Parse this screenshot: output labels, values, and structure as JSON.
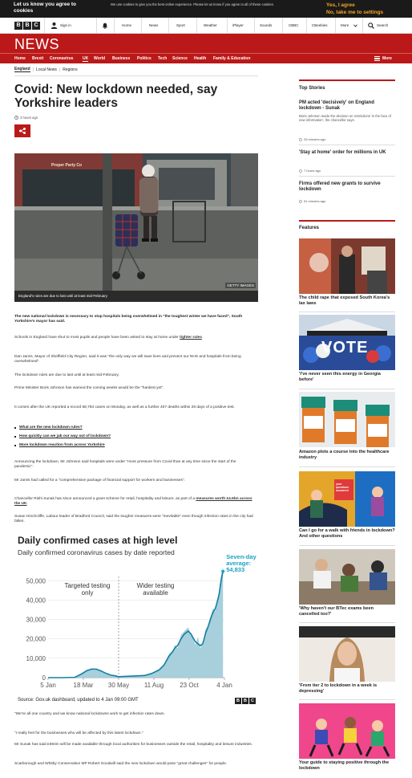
{
  "cookie": {
    "title": "Let us know you agree to cookies",
    "message": "We use cookies to give you the best online experience. Please let us know if you agree to all of these cookies.",
    "agree": "Yes, I agree",
    "settings": "No, take me to settings"
  },
  "topnav": {
    "signin": "Sign in",
    "items": [
      "Home",
      "News",
      "Sport",
      "Weather",
      "iPlayer",
      "Sounds",
      "CBBC",
      "CBeebies",
      "More"
    ],
    "search": "Search"
  },
  "banner": {
    "title": "NEWS",
    "more": "More"
  },
  "sections": [
    "Home",
    "Brexit",
    "Coronavirus",
    "UK",
    "World",
    "Business",
    "Politics",
    "Tech",
    "Science",
    "Health",
    "Family & Education"
  ],
  "subnav": [
    "England",
    "Local News",
    "Regions"
  ],
  "article": {
    "headline": "Covid: New lockdown needed, say Yorkshire leaders",
    "time": "3 hours ago",
    "image_caption": "England's rules are due to last until at least mid-February",
    "image_credit": "GETTY IMAGES",
    "image_shop": "Proper Party Co",
    "lead": "The new national lockdown is necessary to stop hospitals being overwhelmed in \"the toughest winter we have faced\", South Yorkshire's mayor has said.",
    "p1a": "Schools in England have shut to most pupils and people have been asked to stay at home under ",
    "p1link": "tighter rules",
    "p1b": ".",
    "p2": "Dan Jarvis, Mayor of Sheffield City Region, said it was \"the only way we will save lives and prevent our NHS and hospitals from being overwhelmed\".",
    "p3": "The lockdown rules are due to last until at least mid-February.",
    "p4": "Prime Minister Boris Johnson has warned the coming weeks would be the \"hardest yet\".",
    "p5": "It comes after the UK reported a record 58,784 cases on Monday, as well as a further 407 deaths within 28 days of a positive test.",
    "bullets": [
      "What are the new lockdown rules?",
      "How quickly can we jab our way out of lockdown?",
      "More lockdown reaction from across Yorkshire"
    ],
    "p6": "Announcing the lockdown, Mr Johnson said hospitals were under \"more pressure from Covid than at any time since the start of the pandemic\".",
    "p7": "Mr Jarvis had called for a \"comprehensive package of financial support for workers and businesses\".",
    "p8a": "Chancellor Rishi Sunak has since announced a grant scheme for retail, hospitality and leisure, as part of a ",
    "p8link": "measures worth £4.6bn across the UK",
    "p8b": ".",
    "p9": "Susan Hinchcliffe, Labour leader of Bradford Council, said the tougher measures were \"inevitable\" even though infection rates in the city had fallen.",
    "p10": "\"We're all one country and we know national lockdowns work to get infection rates down.",
    "p11": "\"I really feel for the businesses who will be affected by this latest lockdown.\"",
    "p12": "Mr Sunak has said £594m will be made available through local authorities for businesses outside the retail, hospitality and leisure industries.",
    "p13": "Scarborough and Whitby Conservative MP Robert Goodwill said the new lockdown would pose \"great challenges\" for people."
  },
  "chart_data": {
    "type": "area",
    "title": "Daily confirmed cases at high level",
    "subtitle": "Daily confirmed coronavirus cases by date reported",
    "x_ticks": [
      "5 Jan",
      "18 Mar",
      "30 May",
      "11 Aug",
      "23 Oct",
      "4 Jan"
    ],
    "y_ticks": [
      "0",
      "10,000",
      "20,000",
      "30,000",
      "40,000",
      "50,000"
    ],
    "ylim": [
      0,
      58000
    ],
    "annotations": [
      "Targeted testing only",
      "Wider testing available"
    ],
    "callout": "Seven-day average: 54,833",
    "source": "Source: Gov.uk dashboard, updated to 4 Jan 09:00 GMT",
    "x_days": [
      0,
      30,
      55,
      70,
      80,
      90,
      100,
      110,
      120,
      130,
      140,
      145,
      160,
      180,
      200,
      215,
      230,
      240,
      250,
      258,
      263,
      268,
      275,
      282,
      290,
      296,
      300,
      305,
      310,
      315,
      320,
      323,
      326,
      330,
      334,
      338,
      342,
      346,
      350,
      354,
      358,
      362
    ],
    "values": [
      0,
      0,
      200,
      2500,
      4000,
      4800,
      4600,
      3500,
      2200,
      1300,
      900,
      500,
      700,
      900,
      1200,
      2500,
      4500,
      7000,
      12000,
      14000,
      17000,
      15000,
      22000,
      24000,
      26000,
      22000,
      20000,
      17000,
      21000,
      15000,
      18000,
      21000,
      25000,
      26000,
      30000,
      33000,
      36000,
      34000,
      40000,
      45000,
      53000,
      57000
    ],
    "avg_values": [
      0,
      0,
      150,
      2000,
      3600,
      4400,
      4400,
      3400,
      2200,
      1300,
      900,
      500,
      650,
      850,
      1100,
      2200,
      4000,
      6500,
      11000,
      13500,
      15500,
      16500,
      20000,
      22500,
      24000,
      22500,
      20500,
      18500,
      17500,
      16500,
      17500,
      20000,
      23000,
      25500,
      28500,
      31500,
      34000,
      35500,
      39000,
      43000,
      50000,
      54833
    ],
    "colors": {
      "area": "#1380a1",
      "avg": "#1a6a86",
      "fill": "#a7cfdc",
      "highlight": "#1ca3c4"
    }
  },
  "sidebar": {
    "top_stories_title": "Top Stories",
    "stories": [
      {
        "title": "PM acted 'decisively' on England lockdown - Sunak",
        "summary": "Boris Johnson made the decision on restrictions 'in the face of new information', the chancellor says.",
        "time": "25 minutes ago"
      },
      {
        "title": "'Stay at home' order for millions in UK",
        "summary": "",
        "time": "7 hours ago"
      },
      {
        "title": "Firms offered new grants to survive lockdown",
        "summary": "",
        "time": "51 minutes ago"
      }
    ],
    "features_title": "Features",
    "features": [
      {
        "title": "The child rape that exposed South Korea's lax laws"
      },
      {
        "title": "'I've never seen this energy in Georgia before'",
        "img_text": "VOTE"
      },
      {
        "title": "Amazon plots a course into the healthcare industry"
      },
      {
        "title": "Can I go for a walk with friends in lockdown? And other questions",
        "img_text": "your questions answered"
      },
      {
        "title": "'Why haven't our BTec exams been cancelled too?'"
      },
      {
        "title": "'From tier 2 to lockdown in a week is depressing'"
      },
      {
        "title": "Your guide to staying positive through the lockdown"
      }
    ]
  },
  "brand": {
    "red": "#bb1919",
    "dark": "#1a1a1a",
    "accent": "#f5a623"
  }
}
